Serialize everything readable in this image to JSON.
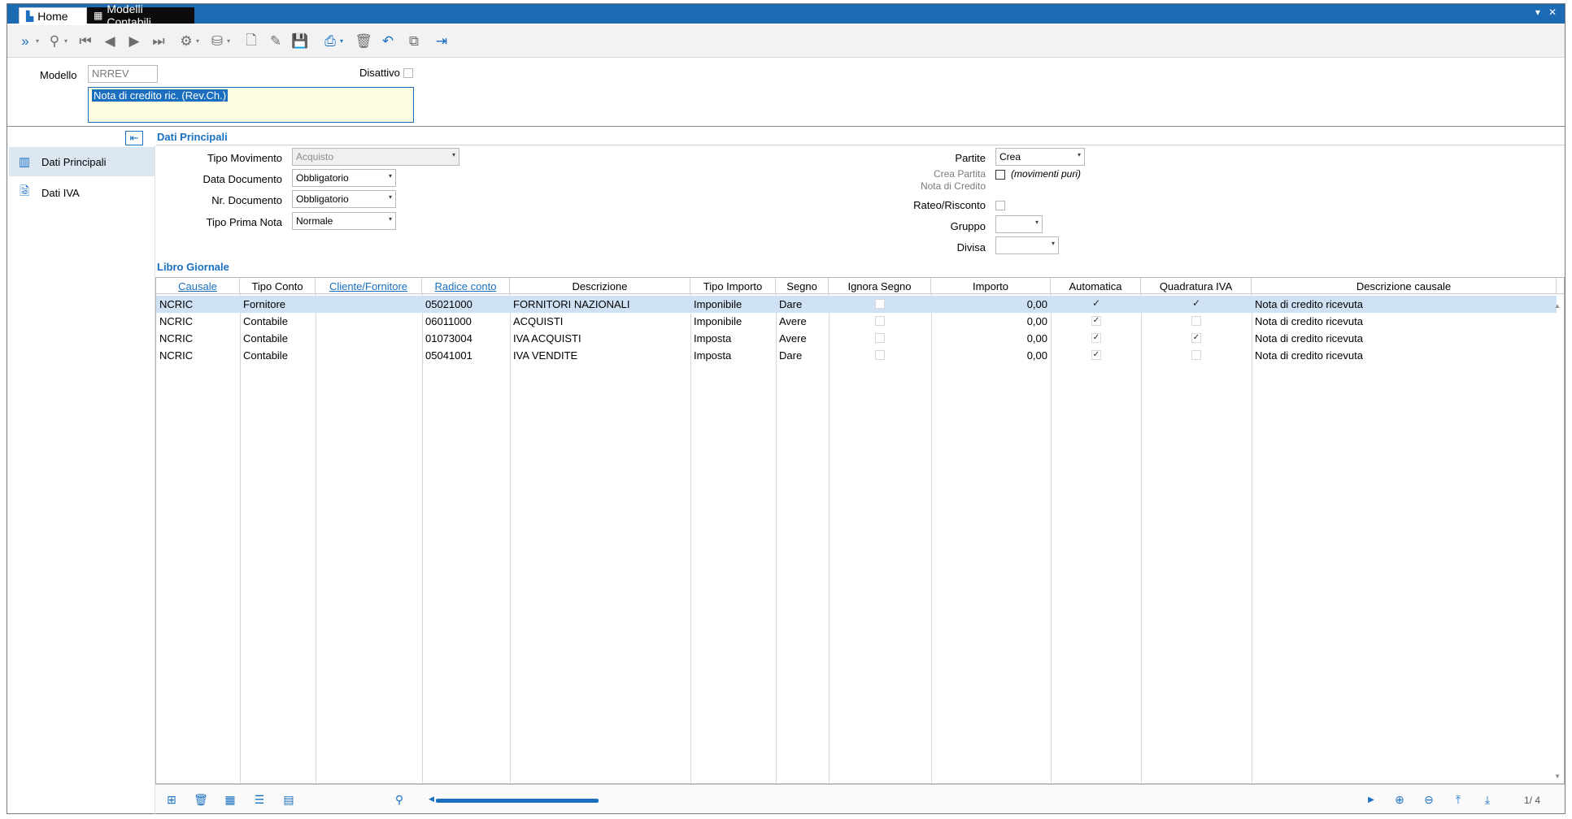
{
  "tabs": {
    "home": "Home",
    "modelli": "Modelli Contabili"
  },
  "header": {
    "modello_label": "Modello",
    "modello_value": "NRREV",
    "disattivo_label": "Disattivo",
    "descrizione_value": "Nota di credito ric. (Rev.Ch.)"
  },
  "section": {
    "title": "Dati Principali",
    "libro_title": "Libro Giornale"
  },
  "nav": {
    "item1": "Dati Principali",
    "item2": "Dati IVA"
  },
  "form": {
    "tipo_movimento_label": "Tipo Movimento",
    "tipo_movimento_value": "Acquisto",
    "data_documento_label": "Data Documento",
    "data_documento_value": "Obbligatorio",
    "nr_documento_label": "Nr. Documento",
    "nr_documento_value": "Obbligatorio",
    "tipo_prima_nota_label": "Tipo Prima Nota",
    "tipo_prima_nota_value": "Normale",
    "partite_label": "Partite",
    "partite_value": "Crea",
    "crea_partita_label_1": "Crea Partita",
    "crea_partita_label_2": "Nota di Credito",
    "movimenti_puri": "(movimenti puri)",
    "rateo_label": "Rateo/Risconto",
    "gruppo_label": "Gruppo",
    "divisa_label": "Divisa"
  },
  "grid": {
    "headers": {
      "causale": "Causale",
      "tipo_conto": "Tipo Conto",
      "cliente": "Cliente/Fornitore",
      "radice": "Radice conto",
      "descrizione": "Descrizione",
      "tipo_importo": "Tipo Importo",
      "segno": "Segno",
      "ignora": "Ignora Segno",
      "importo": "Importo",
      "automatica": "Automatica",
      "quadratura": "Quadratura IVA",
      "desc_causale": "Descrizione causale"
    },
    "rows": [
      {
        "causale": "NCRIC",
        "tipo_conto": "Fornitore",
        "radice": "05021000",
        "descrizione": "FORNITORI NAZIONALI",
        "tipo_importo": "Imponibile",
        "segno": "Dare",
        "importo": "0,00",
        "desc_causale": "Nota di credito ricevuta"
      },
      {
        "causale": "NCRIC",
        "tipo_conto": "Contabile",
        "radice": "06011000",
        "descrizione": "ACQUISTI",
        "tipo_importo": "Imponibile",
        "segno": "Avere",
        "importo": "0,00",
        "desc_causale": "Nota di credito ricevuta"
      },
      {
        "causale": "NCRIC",
        "tipo_conto": "Contabile",
        "radice": "01073004",
        "descrizione": "IVA ACQUISTI",
        "tipo_importo": "Imposta",
        "segno": "Avere",
        "importo": "0,00",
        "desc_causale": "Nota di credito ricevuta"
      },
      {
        "causale": "NCRIC",
        "tipo_conto": "Contabile",
        "radice": "05041001",
        "descrizione": "IVA VENDITE",
        "tipo_importo": "Imposta",
        "segno": "Dare",
        "importo": "0,00",
        "desc_causale": "Nota di credito ricevuta"
      }
    ],
    "pager": "1/  4"
  }
}
